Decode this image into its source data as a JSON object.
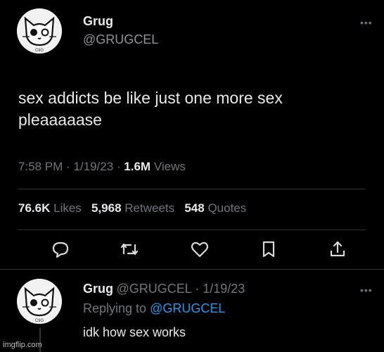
{
  "tweet": {
    "name": "Grug",
    "handle": "@GRUGCEL",
    "text_line1": "sex addicts be like just one more sex",
    "text_line2": "pleaaaaase",
    "time": "7:58 PM",
    "date": "1/19/23",
    "views_count": "1.6M",
    "views_label": "Views",
    "likes_count": "76.6K",
    "likes_label": "Likes",
    "retweets_count": "5,968",
    "retweets_label": "Retweets",
    "quotes_count": "548",
    "quotes_label": "Quotes",
    "more_icon": "more-dots-icon"
  },
  "actions": [
    "reply-icon",
    "retweet-icon",
    "like-icon",
    "bookmark-icon",
    "share-icon"
  ],
  "reply": {
    "name": "Grug",
    "handle": "@GRUGCEL",
    "date": "1/19/23",
    "replying_prefix": "Replying to",
    "replying_handle": "@GRUGCEL",
    "text": "idk how sex works"
  },
  "avatar_caption": "CtiG",
  "watermark": "imgflip.com",
  "colors": {
    "background": "#000000",
    "text": "#e7e9ea",
    "muted": "#71767b",
    "link": "#1d9bf0",
    "divider": "#2f3336"
  }
}
